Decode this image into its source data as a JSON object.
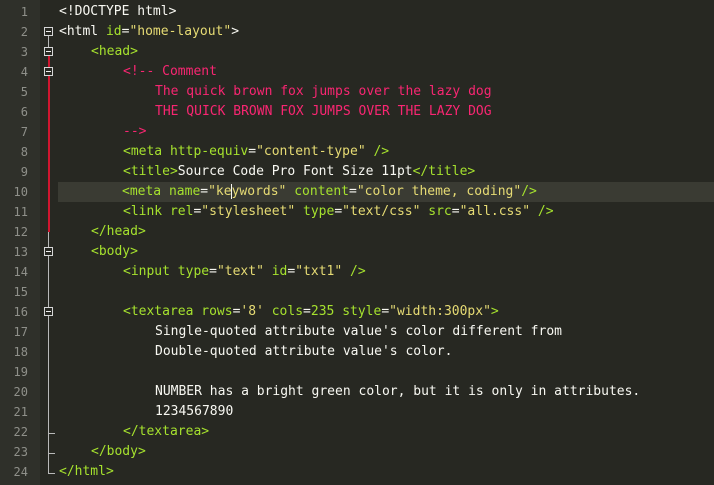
{
  "colors": {
    "background": "#272822",
    "gutter": "#2f302a",
    "line_number": "#8f908a",
    "active_line": "#3a3b33",
    "fold_marker_active": "#d0152f",
    "tag": "#f92672",
    "attribute": "#a6e22e",
    "string": "#e6db74",
    "comment": "#f92672",
    "number": "#a6e22e",
    "text": "#f8f8f2"
  },
  "editor": {
    "lines": [
      {
        "no": "1",
        "fold": "none",
        "indent": 0,
        "tokens": [
          {
            "t": "<!DOCTYPE html>",
            "c": "text"
          }
        ]
      },
      {
        "no": "2",
        "fold": "open",
        "indent": 0,
        "tokens": [
          {
            "t": "<html ",
            "c": "text"
          },
          {
            "t": "id",
            "c": "attribute"
          },
          {
            "t": "=",
            "c": "text"
          },
          {
            "t": "\"home-layout\"",
            "c": "string"
          },
          {
            "t": ">",
            "c": "text"
          }
        ]
      },
      {
        "no": "3",
        "fold": "open",
        "indent": 1,
        "tokens": [
          {
            "t": "<head>",
            "c": "attribute"
          }
        ]
      },
      {
        "no": "4",
        "fold": "open",
        "indent": 2,
        "tokens": [
          {
            "t": "<!-- Comment",
            "c": "tag"
          }
        ]
      },
      {
        "no": "5",
        "fold": "none",
        "indent": 3,
        "tokens": [
          {
            "t": "The quick brown fox jumps over the lazy dog",
            "c": "tag"
          }
        ]
      },
      {
        "no": "6",
        "fold": "none",
        "indent": 3,
        "tokens": [
          {
            "t": "THE QUICK BROWN FOX JUMPS OVER THE LAZY DOG",
            "c": "tag"
          }
        ]
      },
      {
        "no": "7",
        "fold": "none",
        "indent": 2,
        "tokens": [
          {
            "t": "-->",
            "c": "tag"
          }
        ]
      },
      {
        "no": "8",
        "fold": "none",
        "indent": 2,
        "tokens": [
          {
            "t": "<meta ",
            "c": "attribute"
          },
          {
            "t": "http-equiv",
            "c": "attribute"
          },
          {
            "t": "=",
            "c": "text"
          },
          {
            "t": "\"content-type\"",
            "c": "string"
          },
          {
            "t": " />",
            "c": "attribute"
          }
        ]
      },
      {
        "no": "9",
        "fold": "none",
        "indent": 2,
        "tokens": [
          {
            "t": "<title>",
            "c": "attribute"
          },
          {
            "t": "Source Code Pro Font Size 11pt",
            "c": "text"
          },
          {
            "t": "</title>",
            "c": "attribute"
          }
        ]
      },
      {
        "no": "10",
        "fold": "none",
        "indent": 2,
        "tokens": [
          {
            "t": "<meta ",
            "c": "attribute"
          },
          {
            "t": "name",
            "c": "attribute"
          },
          {
            "t": "=",
            "c": "text"
          },
          {
            "t": "\"ke",
            "c": "string"
          },
          {
            "t": "|",
            "c": "cursor"
          },
          {
            "t": "ywords\"",
            "c": "string"
          },
          {
            "t": " ",
            "c": "text"
          },
          {
            "t": "content",
            "c": "attribute"
          },
          {
            "t": "=",
            "c": "text"
          },
          {
            "t": "\"color theme, coding\"",
            "c": "string"
          },
          {
            "t": "/>",
            "c": "attribute"
          }
        ]
      },
      {
        "no": "11",
        "fold": "none",
        "indent": 2,
        "tokens": [
          {
            "t": "<link ",
            "c": "attribute"
          },
          {
            "t": "rel",
            "c": "attribute"
          },
          {
            "t": "=",
            "c": "text"
          },
          {
            "t": "\"stylesheet\"",
            "c": "string"
          },
          {
            "t": " ",
            "c": "text"
          },
          {
            "t": "type",
            "c": "attribute"
          },
          {
            "t": "=",
            "c": "text"
          },
          {
            "t": "\"text/css\"",
            "c": "string"
          },
          {
            "t": " ",
            "c": "text"
          },
          {
            "t": "src",
            "c": "attribute"
          },
          {
            "t": "=",
            "c": "text"
          },
          {
            "t": "\"all.css\"",
            "c": "string"
          },
          {
            "t": " />",
            "c": "attribute"
          }
        ]
      },
      {
        "no": "12",
        "fold": "none",
        "indent": 1,
        "tokens": [
          {
            "t": "</head>",
            "c": "attribute"
          }
        ]
      },
      {
        "no": "13",
        "fold": "open",
        "indent": 1,
        "tokens": [
          {
            "t": "<body>",
            "c": "attribute"
          }
        ]
      },
      {
        "no": "14",
        "fold": "none",
        "indent": 2,
        "tokens": [
          {
            "t": "<input ",
            "c": "attribute"
          },
          {
            "t": "type",
            "c": "attribute"
          },
          {
            "t": "=",
            "c": "text"
          },
          {
            "t": "\"text\"",
            "c": "string"
          },
          {
            "t": " ",
            "c": "text"
          },
          {
            "t": "id",
            "c": "attribute"
          },
          {
            "t": "=",
            "c": "text"
          },
          {
            "t": "\"txt1\"",
            "c": "string"
          },
          {
            "t": " />",
            "c": "attribute"
          }
        ]
      },
      {
        "no": "15",
        "fold": "none",
        "indent": 0,
        "tokens": []
      },
      {
        "no": "16",
        "fold": "open",
        "indent": 2,
        "tokens": [
          {
            "t": "<textarea ",
            "c": "attribute"
          },
          {
            "t": "rows",
            "c": "attribute"
          },
          {
            "t": "=",
            "c": "text"
          },
          {
            "t": "'8'",
            "c": "string"
          },
          {
            "t": " ",
            "c": "text"
          },
          {
            "t": "cols",
            "c": "attribute"
          },
          {
            "t": "=",
            "c": "text"
          },
          {
            "t": "235",
            "c": "number"
          },
          {
            "t": " ",
            "c": "text"
          },
          {
            "t": "style",
            "c": "attribute"
          },
          {
            "t": "=",
            "c": "text"
          },
          {
            "t": "\"width:300px\"",
            "c": "string"
          },
          {
            "t": ">",
            "c": "attribute"
          }
        ]
      },
      {
        "no": "17",
        "fold": "none",
        "indent": 3,
        "tokens": [
          {
            "t": "Single-quoted attribute value's color different from",
            "c": "text"
          }
        ]
      },
      {
        "no": "18",
        "fold": "none",
        "indent": 3,
        "tokens": [
          {
            "t": "Double-quoted attribute value's color.",
            "c": "text"
          }
        ]
      },
      {
        "no": "19",
        "fold": "none",
        "indent": 0,
        "tokens": []
      },
      {
        "no": "20",
        "fold": "none",
        "indent": 3,
        "tokens": [
          {
            "t": "NUMBER has a bright green color, but it is only in attributes.",
            "c": "text"
          }
        ]
      },
      {
        "no": "21",
        "fold": "none",
        "indent": 3,
        "tokens": [
          {
            "t": "1234567890",
            "c": "text"
          }
        ]
      },
      {
        "no": "22",
        "fold": "none",
        "indent": 2,
        "tokens": [
          {
            "t": "</textarea>",
            "c": "attribute"
          }
        ]
      },
      {
        "no": "23",
        "fold": "none",
        "indent": 1,
        "tokens": [
          {
            "t": "</body>",
            "c": "attribute"
          }
        ]
      },
      {
        "no": "24",
        "fold": "none",
        "indent": 0,
        "tokens": [
          {
            "t": "</html>",
            "c": "attribute"
          }
        ]
      }
    ]
  }
}
